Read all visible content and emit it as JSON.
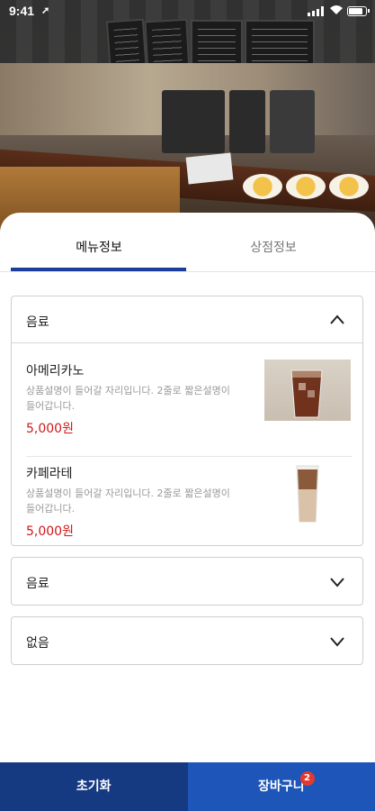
{
  "status_bar": {
    "time": "9:41",
    "location_arrow": "➚"
  },
  "tabs": [
    {
      "label": "메뉴정보",
      "active": true
    },
    {
      "label": "상점정보",
      "active": false
    }
  ],
  "categories": [
    {
      "title": "음료",
      "expanded": true,
      "items": [
        {
          "name": "아메리카노",
          "description": "상품설명이 들어갈 자리입니다. 2줄로 짧은설명이 들어갑니다.",
          "price": "5,000원",
          "image": "iced-americano"
        },
        {
          "name": "카페라테",
          "description": "상품설명이 들어갈 자리입니다. 2줄로 짧은설명이 들어갑니다.",
          "price": "5,000원",
          "image": "iced-latte"
        }
      ]
    },
    {
      "title": "음료",
      "expanded": false
    },
    {
      "title": "없음",
      "expanded": false
    }
  ],
  "bottom_bar": {
    "reset_label": "초기화",
    "cart_label": "장바구니",
    "cart_count": "2"
  },
  "colors": {
    "accent": "#1a3e9a",
    "price": "#d01818",
    "reset_bg": "#163a82",
    "cart_bg": "#1d56b8",
    "badge": "#e23a32"
  }
}
